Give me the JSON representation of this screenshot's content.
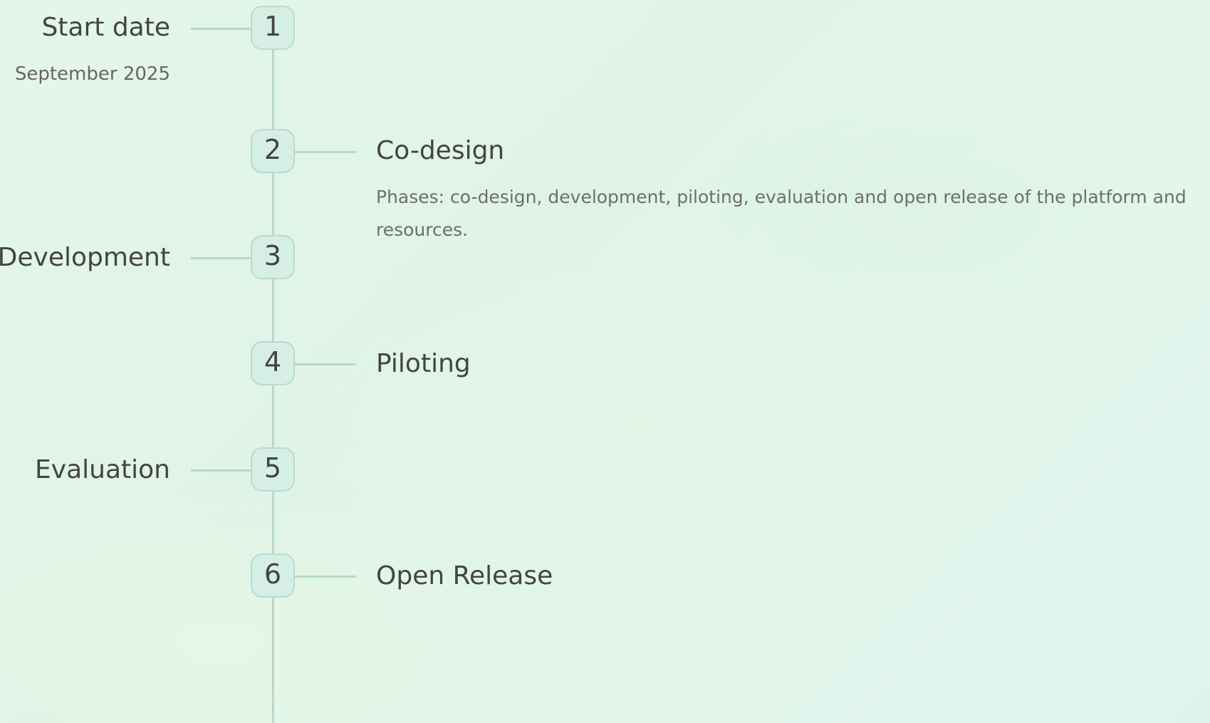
{
  "timeline": {
    "steps": [
      {
        "number": "1",
        "title": "Start date",
        "subtitle": "September 2025",
        "side": "left"
      },
      {
        "number": "2",
        "title": "Co-design",
        "description": "Phases: co-design, development, piloting, evaluation and open release of the platform and resources.",
        "side": "right"
      },
      {
        "number": "3",
        "title": "Development",
        "side": "left"
      },
      {
        "number": "4",
        "title": "Piloting",
        "side": "right"
      },
      {
        "number": "5",
        "title": "Evaluation",
        "side": "left"
      },
      {
        "number": "6",
        "title": "Open Release",
        "side": "right"
      }
    ]
  },
  "colors": {
    "line": "#b7d8cb",
    "node_fill": "#d5efe6",
    "node_border": "#b9dccd",
    "text_dark": "#444444",
    "text_muted": "#6e6e6e"
  }
}
